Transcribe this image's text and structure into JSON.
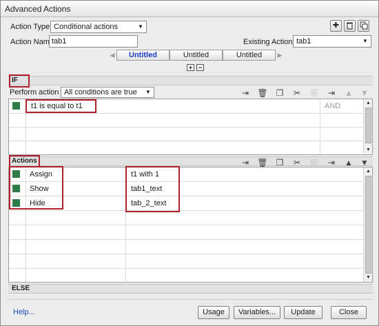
{
  "window": {
    "title": "Advanced Actions"
  },
  "header": {
    "action_type_label": "Action Type:",
    "action_type_value": "Conditional actions",
    "action_name_label": "Action Name:",
    "action_name_value": "tab1",
    "existing_actions_label": "Existing Actions:",
    "existing_actions_value": "tab1"
  },
  "tabs": [
    {
      "label": "Untitled",
      "active": true
    },
    {
      "label": "Untitled",
      "active": false
    },
    {
      "label": "Untitled",
      "active": false
    }
  ],
  "if_section": {
    "label": "IF",
    "perform_label": "Perform action if:",
    "perform_value": "All conditions are true",
    "rows": [
      {
        "condition": "t1   is equal to    t1",
        "operator": "AND"
      }
    ]
  },
  "actions_section": {
    "label": "Actions",
    "rows": [
      {
        "action": "Assign",
        "target": "t1   with    1"
      },
      {
        "action": "Show",
        "target": "tab1_text"
      },
      {
        "action": "Hide",
        "target": "tab_2_text"
      }
    ]
  },
  "else_label": "ELSE",
  "footer": {
    "help": "Help...",
    "usage": "Usage",
    "variables": "Variables...",
    "update": "Update",
    "close": "Close"
  },
  "colors": {
    "highlight_box": "#b0202a",
    "row_marker": "#2e7d48",
    "active_tab": "#1a3cc8",
    "link": "#1c4cbc"
  },
  "icons": [
    "plus-icon",
    "trash-icon",
    "duplicate-icon",
    "insert-row-icon",
    "copy-icon",
    "cut-icon",
    "paste-icon",
    "move-up-icon",
    "move-down-icon"
  ]
}
